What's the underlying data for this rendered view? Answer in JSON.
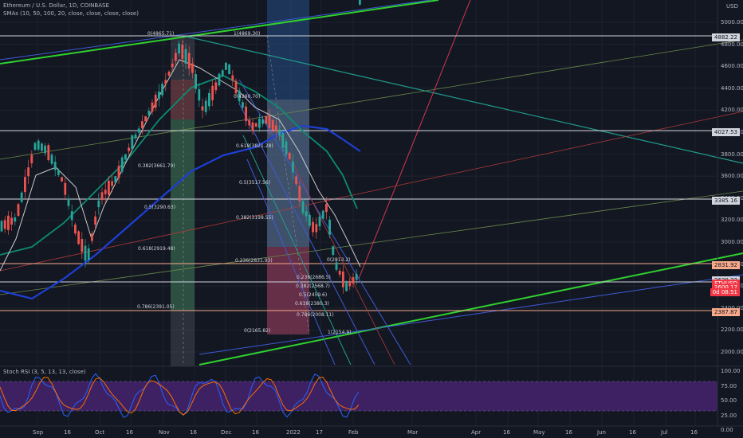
{
  "header": {
    "symbol_line": "Ethereum / U.S. Dollar, 1D, COINBASE",
    "sma_line": "SMAs (10, 50, 100, 20, close, close, close, close)",
    "currency": "USD"
  },
  "stoch": {
    "label": "Stoch RSI (3, 5, 13, 13, close)",
    "ticks": [
      "100.00",
      "75.00",
      "50.00",
      "25.00",
      "0.00"
    ]
  },
  "price_axis": {
    "ticks": [
      "5000.00",
      "4800.00",
      "4600.00",
      "4400.00",
      "4200.00",
      "4000.00",
      "3800.00",
      "3600.00",
      "3400.00",
      "3200.00",
      "3000.00",
      "2800.00",
      "2600.00",
      "2400.00",
      "2200.00",
      "2000.00"
    ]
  },
  "time_axis": {
    "ticks": [
      "Sep",
      "16",
      "Oct",
      "16",
      "Nov",
      "16",
      "Dec",
      "16",
      "2022",
      "17",
      "Feb",
      "Mar",
      "Apr",
      "16",
      "May",
      "16",
      "Jun",
      "16",
      "Jul",
      "16"
    ]
  },
  "price_tags": [
    {
      "text": "4882.22",
      "color": "#d1d4dc"
    },
    {
      "text": "4027.53",
      "color": "#d1d4dc"
    },
    {
      "text": "3385.16",
      "color": "#d1d4dc"
    },
    {
      "text": "2831.92",
      "color": "#f7a98a"
    },
    {
      "text": "2639.22",
      "color": "#d1d4dc"
    },
    {
      "text": "ETHUSD",
      "color": "#f23645"
    },
    {
      "text": "2600.17",
      "color": "#f23645"
    },
    {
      "text": "0d 08:51",
      "color": "#f23645"
    },
    {
      "text": "2387.87",
      "color": "#f7a98a"
    }
  ],
  "fib_labels": [
    "0(4865.71)",
    "1(4869.30)",
    "0(4290.70)",
    "0.382(3661.79)",
    "0.618(3821.28)",
    "0.5(3290.63)",
    "0.5(3517.56)",
    "0.382(3198.55)",
    "0.618(2919.48)",
    "0.236(2831.93)",
    "0.786(2391.05)",
    "0(2165.82)",
    "0(2813.2)",
    "0.236(2686.5)",
    "0.382(2568.7)",
    "0.5(2459.6)",
    "0.618(2380.3)",
    "0.786(2008.11)",
    "1(2154.9)"
  ],
  "colors": {
    "background": "#131722",
    "grid": "#1e222d",
    "up": "#26a69a",
    "down": "#ef5350",
    "green_trend": "#2fd12f",
    "blue_sma": "#1e3fd6",
    "teal_sma": "#0c8c71",
    "white_sma": "#c9c9c9",
    "stoch_fill": "#3d2162"
  }
}
